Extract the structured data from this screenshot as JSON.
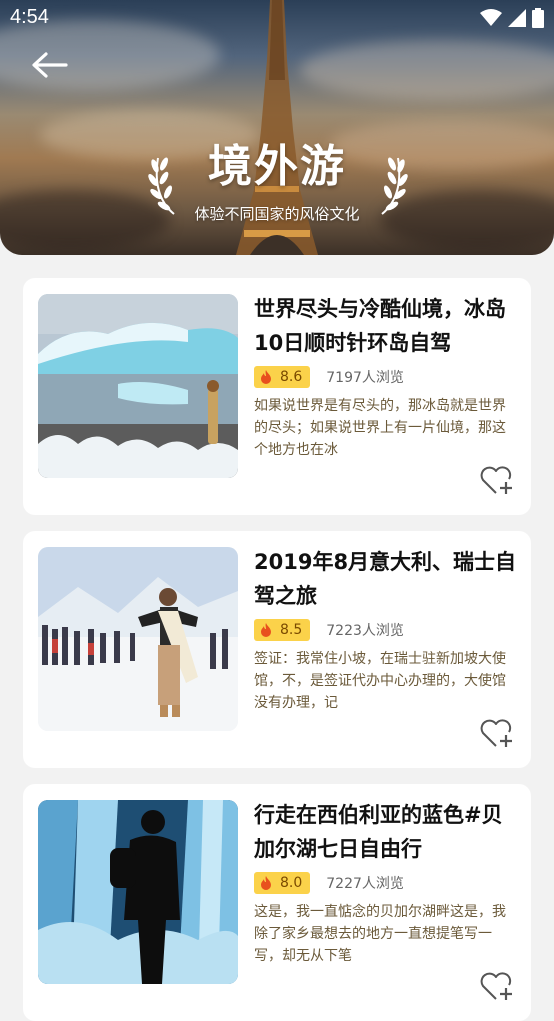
{
  "status_bar": {
    "time": "4:54"
  },
  "header": {
    "title": "境外游",
    "subtitle": "体验不同国家的风俗文化"
  },
  "cards": [
    {
      "title": "世界尽头与冷酷仙境，冰岛10日顺时针环岛自驾",
      "rating": "8.6",
      "views": "7197人浏览",
      "desc": "如果说世界是有尽头的，那冰岛就是世界的尽头；如果说世界上有一片仙境，那这个地方也在冰"
    },
    {
      "title": "2019年8月意大利、瑞士自驾之旅",
      "rating": "8.5",
      "views": "7223人浏览",
      "desc": "签证：我常住小坡，在瑞士驻新加坡大使馆，不，是签证代办中心办理的，大使馆没有办理，记"
    },
    {
      "title": "行走在西伯利亚的蓝色#贝加尔湖七日自由行",
      "rating": "8.0",
      "views": "7227人浏览",
      "desc": "这是，我一直惦念的贝加尔湖畔这是，我除了家乡最想去的地方一直想提笔写一写，却无从下笔"
    }
  ],
  "icons": {
    "back": "arrow-left-icon",
    "fire": "fire-icon",
    "favorite": "heart-plus-icon"
  },
  "colors": {
    "rating_bg": "#fbd24a",
    "fire": "#e8501e",
    "desc_text": "#6b5a3a"
  }
}
